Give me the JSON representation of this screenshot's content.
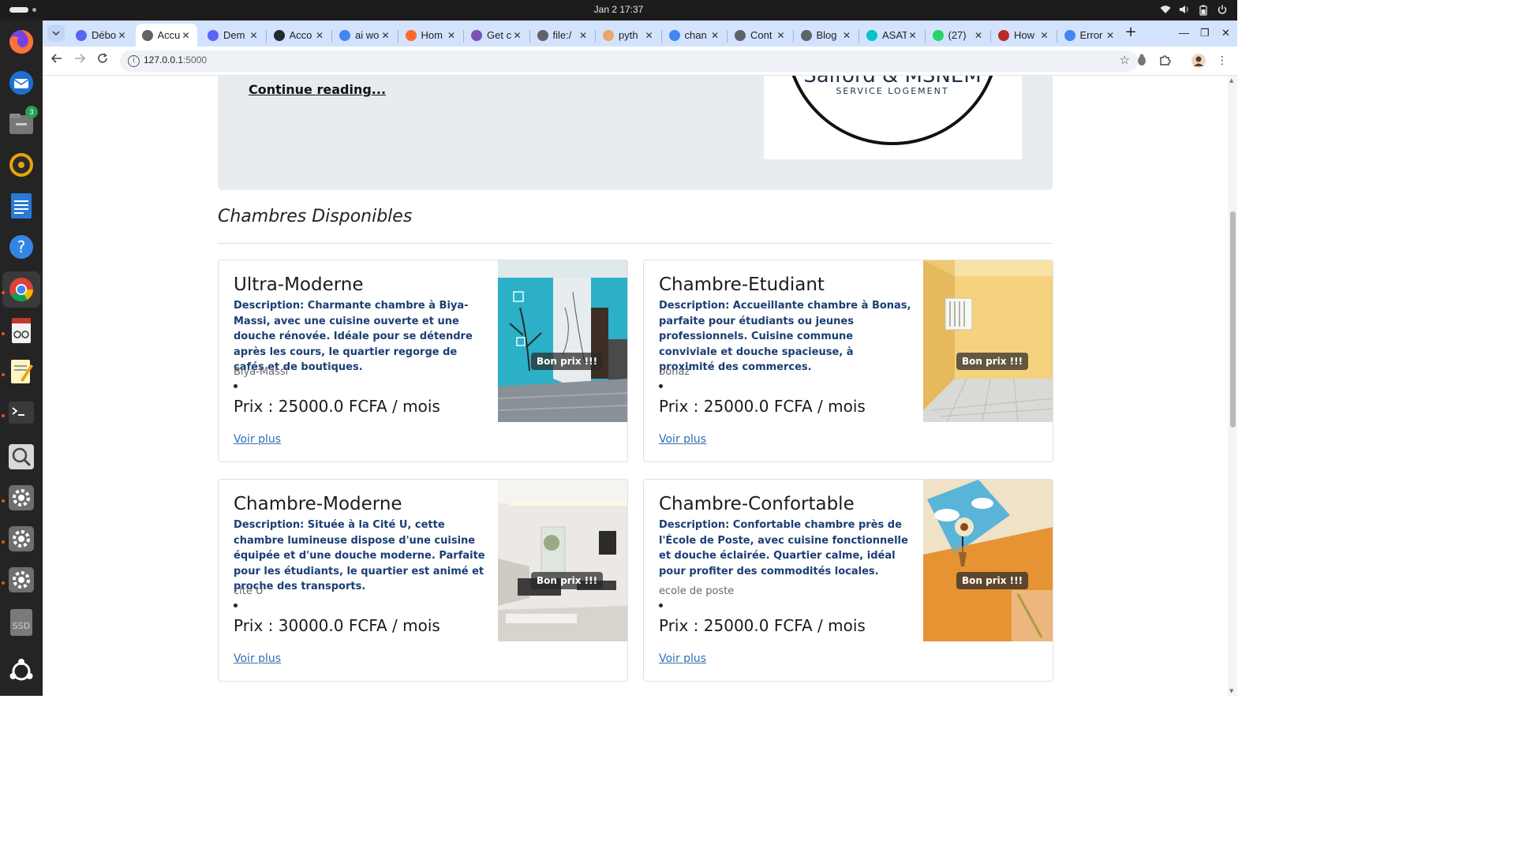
{
  "os": {
    "clock": "Jan 2  17:37",
    "dock_badge": "3",
    "dock_ssd_label": "SSD"
  },
  "browser": {
    "tabs": [
      {
        "title": "Débo",
        "favicon": "discord-icon",
        "color": "#5865f2"
      },
      {
        "title": "Accu",
        "favicon": "globe-icon",
        "color": "#5f6368",
        "active": true
      },
      {
        "title": "Dem",
        "favicon": "discord-icon",
        "color": "#5865f2"
      },
      {
        "title": "Acco",
        "favicon": "github-icon",
        "color": "#24292f"
      },
      {
        "title": "ai wo",
        "favicon": "google-icon",
        "color": "#4285f4"
      },
      {
        "title": "Hom",
        "favicon": "arrow-icon",
        "color": "#ff6b2c"
      },
      {
        "title": "Get c",
        "favicon": "bootstrap-icon",
        "color": "#7952b3"
      },
      {
        "title": "file:/",
        "favicon": "globe-icon",
        "color": "#5f6368"
      },
      {
        "title": "pyth",
        "favicon": "python-icon",
        "color": "#e7a86a"
      },
      {
        "title": "chan",
        "favicon": "google-icon",
        "color": "#4285f4"
      },
      {
        "title": "Cont",
        "favicon": "globe-icon",
        "color": "#5f6368"
      },
      {
        "title": "Blog",
        "favicon": "globe-icon",
        "color": "#5f6368"
      },
      {
        "title": "ASAT",
        "favicon": "canva-icon",
        "color": "#00c4cc"
      },
      {
        "title": "(27)",
        "favicon": "whatsapp-icon",
        "color": "#25d366"
      },
      {
        "title": "How",
        "favicon": "quora-icon",
        "color": "#b92b27"
      },
      {
        "title": "Error",
        "favicon": "google-icon",
        "color": "#4285f4"
      }
    ],
    "close_glyph": "✕",
    "new_tab_glyph": "+",
    "url_host": "127.0.0.1",
    "url_port": ":5000"
  },
  "page": {
    "continue_reading": "Continue reading...",
    "logo": {
      "name": "Salford & MSNEM",
      "tagline": "SERVICE LOGEMENT"
    },
    "section_title": "Chambres Disponibles",
    "cards": [
      {
        "title": "Ultra-Moderne",
        "description": "Description: Charmante chambre à Biya-Massi, avec une cuisine ouverte et une douche rénovée. Idéale pour se détendre après les cours, le quartier regorge de cafés et de boutiques.",
        "location": "Biya-Massi",
        "price": "Prix : 25000.0 FCFA / mois",
        "more": "Voir plus",
        "tag": "Bon prix !!!"
      },
      {
        "title": "Chambre-Etudiant",
        "description": "Description: Accueillante chambre à Bonas, parfaite pour étudiants ou jeunes professionnels. Cuisine commune conviviale et douche spacieuse, à proximité des commerces.",
        "location": "bonaz",
        "price": "Prix : 25000.0 FCFA / mois",
        "more": "Voir plus",
        "tag": "Bon prix !!!"
      },
      {
        "title": "Chambre-Moderne",
        "description": "Description: Située à la Cité U, cette chambre lumineuse dispose d'une cuisine équipée et d'une douche moderne. Parfaite pour les étudiants, le quartier est animé et proche des transports.",
        "location": "cite U",
        "price": "Prix : 30000.0 FCFA / mois",
        "more": "Voir plus",
        "tag": "Bon prix !!!"
      },
      {
        "title": "Chambre-Confortable",
        "description": "Description: Confortable chambre près de l'École de Poste, avec cuisine fonctionnelle et douche éclairée. Quartier calme, idéal pour profiter des commodités locales.",
        "location": "ecole de poste",
        "price": "Prix : 25000.0 FCFA / mois",
        "more": "Voir plus",
        "tag": "Bon prix !!!"
      }
    ]
  }
}
